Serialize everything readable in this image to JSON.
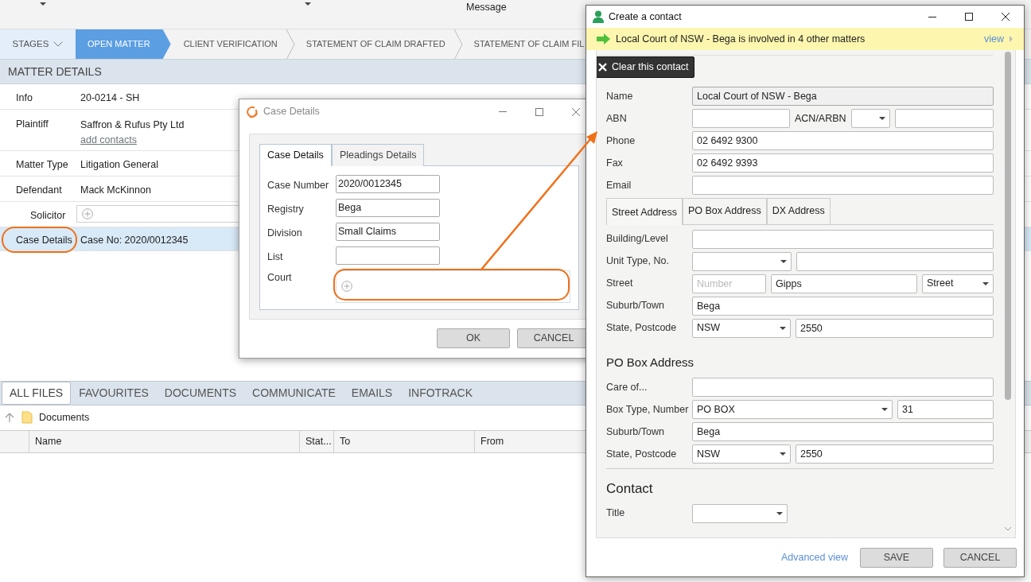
{
  "toolbar": {
    "label": "Message"
  },
  "stages": {
    "label": "STAGES",
    "items": [
      {
        "label": "OPEN MATTER",
        "selected": true
      },
      {
        "label": "CLIENT VERIFICATION",
        "selected": false
      },
      {
        "label": "STATEMENT OF CLAIM DRAFTED",
        "selected": false
      },
      {
        "label": "STATEMENT OF CLAIM FIL",
        "selected": false
      }
    ]
  },
  "matter_details": {
    "title": "MATTER DETAILS",
    "rows": [
      {
        "kind": "text",
        "label": "Info",
        "value": "20-0214 - SH",
        "selected": false
      },
      {
        "kind": "text",
        "label": "Plaintiff",
        "value": "Saffron & Rufus Pty Ltd",
        "link": "add contacts",
        "selected": false
      },
      {
        "kind": "text",
        "label": "Matter Type",
        "value": "Litigation General",
        "selected": false
      },
      {
        "kind": "text",
        "label": "Defendant",
        "value": "Mack McKinnon",
        "selected": false
      },
      {
        "kind": "add-field",
        "label": "Solicitor",
        "selected": false
      },
      {
        "kind": "text",
        "label": "Case Details",
        "value": "Case No: 2020/0012345",
        "selected": true
      }
    ]
  },
  "file_tabs": [
    {
      "label": "ALL FILES",
      "selected": true
    },
    {
      "label": "FAVOURITES",
      "selected": false
    },
    {
      "label": "DOCUMENTS",
      "selected": false
    },
    {
      "label": "COMMUNICATE",
      "selected": false
    },
    {
      "label": "EMAILS",
      "selected": false
    },
    {
      "label": "INFOTRACK",
      "selected": false
    }
  ],
  "breadcrumb": "Documents",
  "file_columns": [
    "Name",
    "Stat...",
    "To",
    "From"
  ],
  "case_dialog": {
    "title": "Case Details",
    "tabs": [
      {
        "label": "Case Details",
        "selected": true
      },
      {
        "label": "Pleadings Details",
        "selected": false
      }
    ],
    "fields": [
      {
        "kind": "text",
        "label": "Case Number",
        "value": "2020/0012345"
      },
      {
        "kind": "text",
        "label": "Registry",
        "value": "Bega"
      },
      {
        "kind": "text",
        "label": "Division",
        "value": "Small Claims"
      },
      {
        "kind": "text",
        "label": "List"
      },
      {
        "kind": "add-field",
        "label": "Court"
      }
    ],
    "buttons": [
      "OK",
      "CANCEL"
    ]
  },
  "contact_dialog": {
    "title": "Create a contact",
    "notice": "Local Court of NSW - Bega is involved in 4 other matters",
    "notice_link": "view",
    "clear_button": "Clear this contact",
    "sections": [
      {
        "kind": "fields",
        "rows": [
          {
            "kind": "single",
            "label": "Name",
            "controls": [
              {
                "kind": "readonly",
                "value": "Local Court of NSW - Bega"
              }
            ]
          },
          {
            "kind": "abn",
            "label": "ABN",
            "controls": [
              {
                "kind": "text"
              },
              {
                "kind": "label",
                "value": "ACN/ARBN"
              },
              {
                "kind": "select"
              },
              {
                "kind": "text"
              }
            ]
          },
          {
            "kind": "single",
            "label": "Phone",
            "controls": [
              {
                "kind": "text",
                "value": "02 6492 9300"
              }
            ]
          },
          {
            "kind": "single",
            "label": "Fax",
            "controls": [
              {
                "kind": "text",
                "value": "02 6492 9393"
              }
            ]
          },
          {
            "kind": "single",
            "label": "Email",
            "controls": [
              {
                "kind": "text"
              }
            ]
          }
        ]
      },
      {
        "kind": "tabs",
        "tabs": [
          {
            "label": "Street Address",
            "selected": true
          },
          {
            "label": "PO Box Address",
            "selected": false
          },
          {
            "label": "DX Address",
            "selected": false
          }
        ]
      },
      {
        "kind": "fields",
        "rows": [
          {
            "kind": "single",
            "label": "Building/Level",
            "controls": [
              {
                "kind": "text"
              }
            ]
          },
          {
            "kind": "unit",
            "label": "Unit Type, No.",
            "controls": [
              {
                "kind": "select"
              },
              {
                "kind": "text"
              }
            ]
          },
          {
            "kind": "street",
            "label": "Street",
            "controls": [
              {
                "kind": "text",
                "placeholder": "Number"
              },
              {
                "kind": "text",
                "value": "Gipps"
              },
              {
                "kind": "select",
                "value": "Street"
              }
            ]
          },
          {
            "kind": "single",
            "label": "Suburb/Town",
            "controls": [
              {
                "kind": "text",
                "value": "Bega"
              }
            ]
          },
          {
            "kind": "state",
            "label": "State, Postcode",
            "controls": [
              {
                "kind": "select",
                "value": "NSW"
              },
              {
                "kind": "text",
                "value": "2550"
              }
            ]
          }
        ]
      },
      {
        "kind": "subheading",
        "title": "PO Box Address"
      },
      {
        "kind": "fields",
        "rows": [
          {
            "kind": "single",
            "label": "Care of...",
            "controls": [
              {
                "kind": "text"
              }
            ]
          },
          {
            "kind": "box",
            "label": "Box Type, Number",
            "controls": [
              {
                "kind": "select",
                "value": "PO BOX"
              },
              {
                "kind": "text",
                "value": "31"
              }
            ]
          },
          {
            "kind": "single",
            "label": "Suburb/Town",
            "controls": [
              {
                "kind": "text",
                "value": "Bega"
              }
            ]
          },
          {
            "kind": "state",
            "label": "State, Postcode",
            "controls": [
              {
                "kind": "select",
                "value": "NSW"
              },
              {
                "kind": "text",
                "value": "2550"
              }
            ]
          }
        ]
      },
      {
        "kind": "divider"
      },
      {
        "kind": "heading",
        "title": "Contact"
      },
      {
        "kind": "fields",
        "rows": [
          {
            "kind": "short",
            "label": "Title",
            "controls": [
              {
                "kind": "select"
              }
            ]
          }
        ]
      }
    ],
    "advanced_link": "Advanced view",
    "buttons": [
      "SAVE",
      "CANCEL"
    ]
  }
}
